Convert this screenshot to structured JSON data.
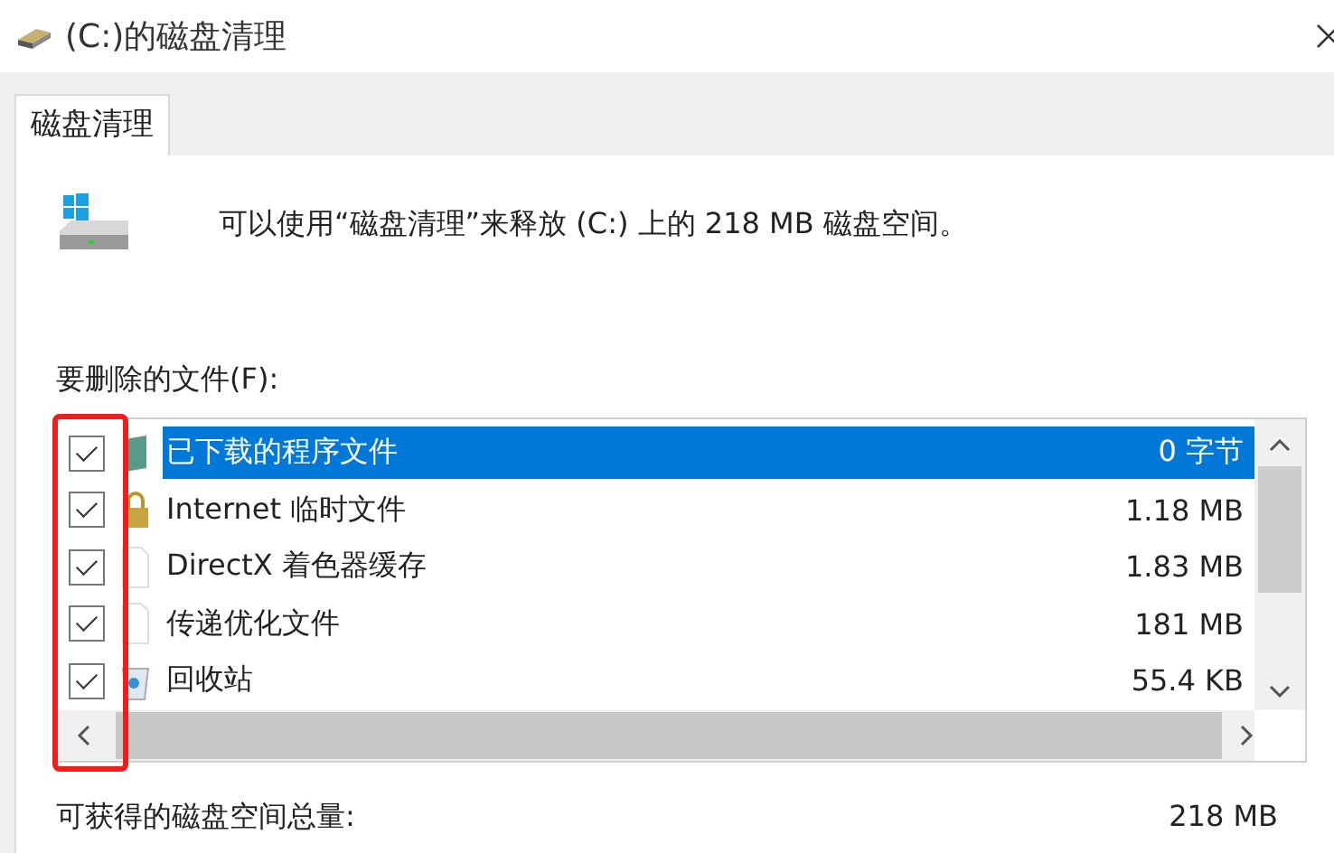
{
  "window": {
    "title": "(C:)的磁盘清理"
  },
  "tabs": [
    {
      "label": "磁盘清理",
      "selected": true
    }
  ],
  "description": "可以使用“磁盘清理”来释放  (C:) 上的 218 MB 磁盘空间。",
  "files_label": "要删除的文件(F):",
  "files": [
    {
      "name": "已下载的程序文件",
      "size": "0 字节",
      "checked": true,
      "selected": true,
      "kind": "program"
    },
    {
      "name": "Internet 临时文件",
      "size": "1.18 MB",
      "checked": true,
      "selected": false,
      "kind": "lock"
    },
    {
      "name": "DirectX 着色器缓存",
      "size": "1.83 MB",
      "checked": true,
      "selected": false,
      "kind": "file"
    },
    {
      "name": "传递优化文件",
      "size": "181 MB",
      "checked": true,
      "selected": false,
      "kind": "file"
    },
    {
      "name": "回收站",
      "size": "55.4 KB",
      "checked": true,
      "selected": false,
      "kind": "recycle"
    }
  ],
  "total": {
    "label": "可获得的磁盘空间总量:",
    "value": "218 MB"
  }
}
